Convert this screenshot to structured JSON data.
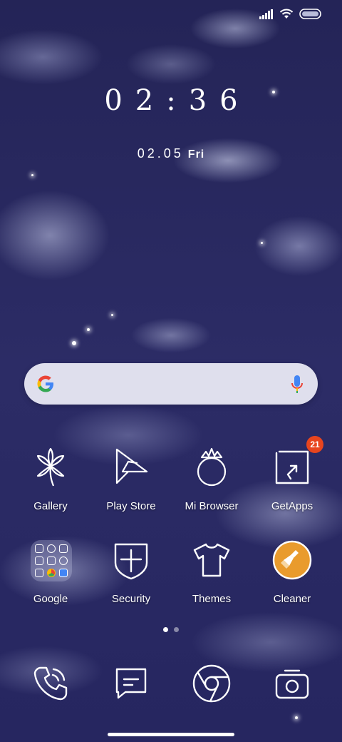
{
  "status_bar": {
    "icons": [
      "signal-icon",
      "wifi-icon",
      "battery-icon"
    ]
  },
  "clock": {
    "time": "02:36",
    "date": "02.05",
    "day": "Fri"
  },
  "search_bar": {
    "icons": [
      "google-g-icon",
      "microphone-icon"
    ]
  },
  "apps_row1": [
    {
      "label": "Gallery",
      "icon": "flower-icon"
    },
    {
      "label": "Play Store",
      "icon": "play-store-icon"
    },
    {
      "label": "Mi Browser",
      "icon": "crown-ring-icon"
    },
    {
      "label": "GetApps",
      "icon": "getapps-icon",
      "badge": "21"
    }
  ],
  "apps_row2": [
    {
      "label": "Google",
      "icon": "folder-icon"
    },
    {
      "label": "Security",
      "icon": "shield-icon"
    },
    {
      "label": "Themes",
      "icon": "tshirt-icon"
    },
    {
      "label": "Cleaner",
      "icon": "broom-icon"
    }
  ],
  "page_indicator": {
    "count": 2,
    "active": 0
  },
  "dock": [
    {
      "icon": "phone-icon"
    },
    {
      "icon": "messages-icon"
    },
    {
      "icon": "chrome-icon"
    },
    {
      "icon": "camera-icon"
    }
  ],
  "colors": {
    "wallpaper": "#28285e",
    "badge": "#e8451e",
    "cleaner": "#e99b2d",
    "search_bg": "#ebebf5"
  }
}
